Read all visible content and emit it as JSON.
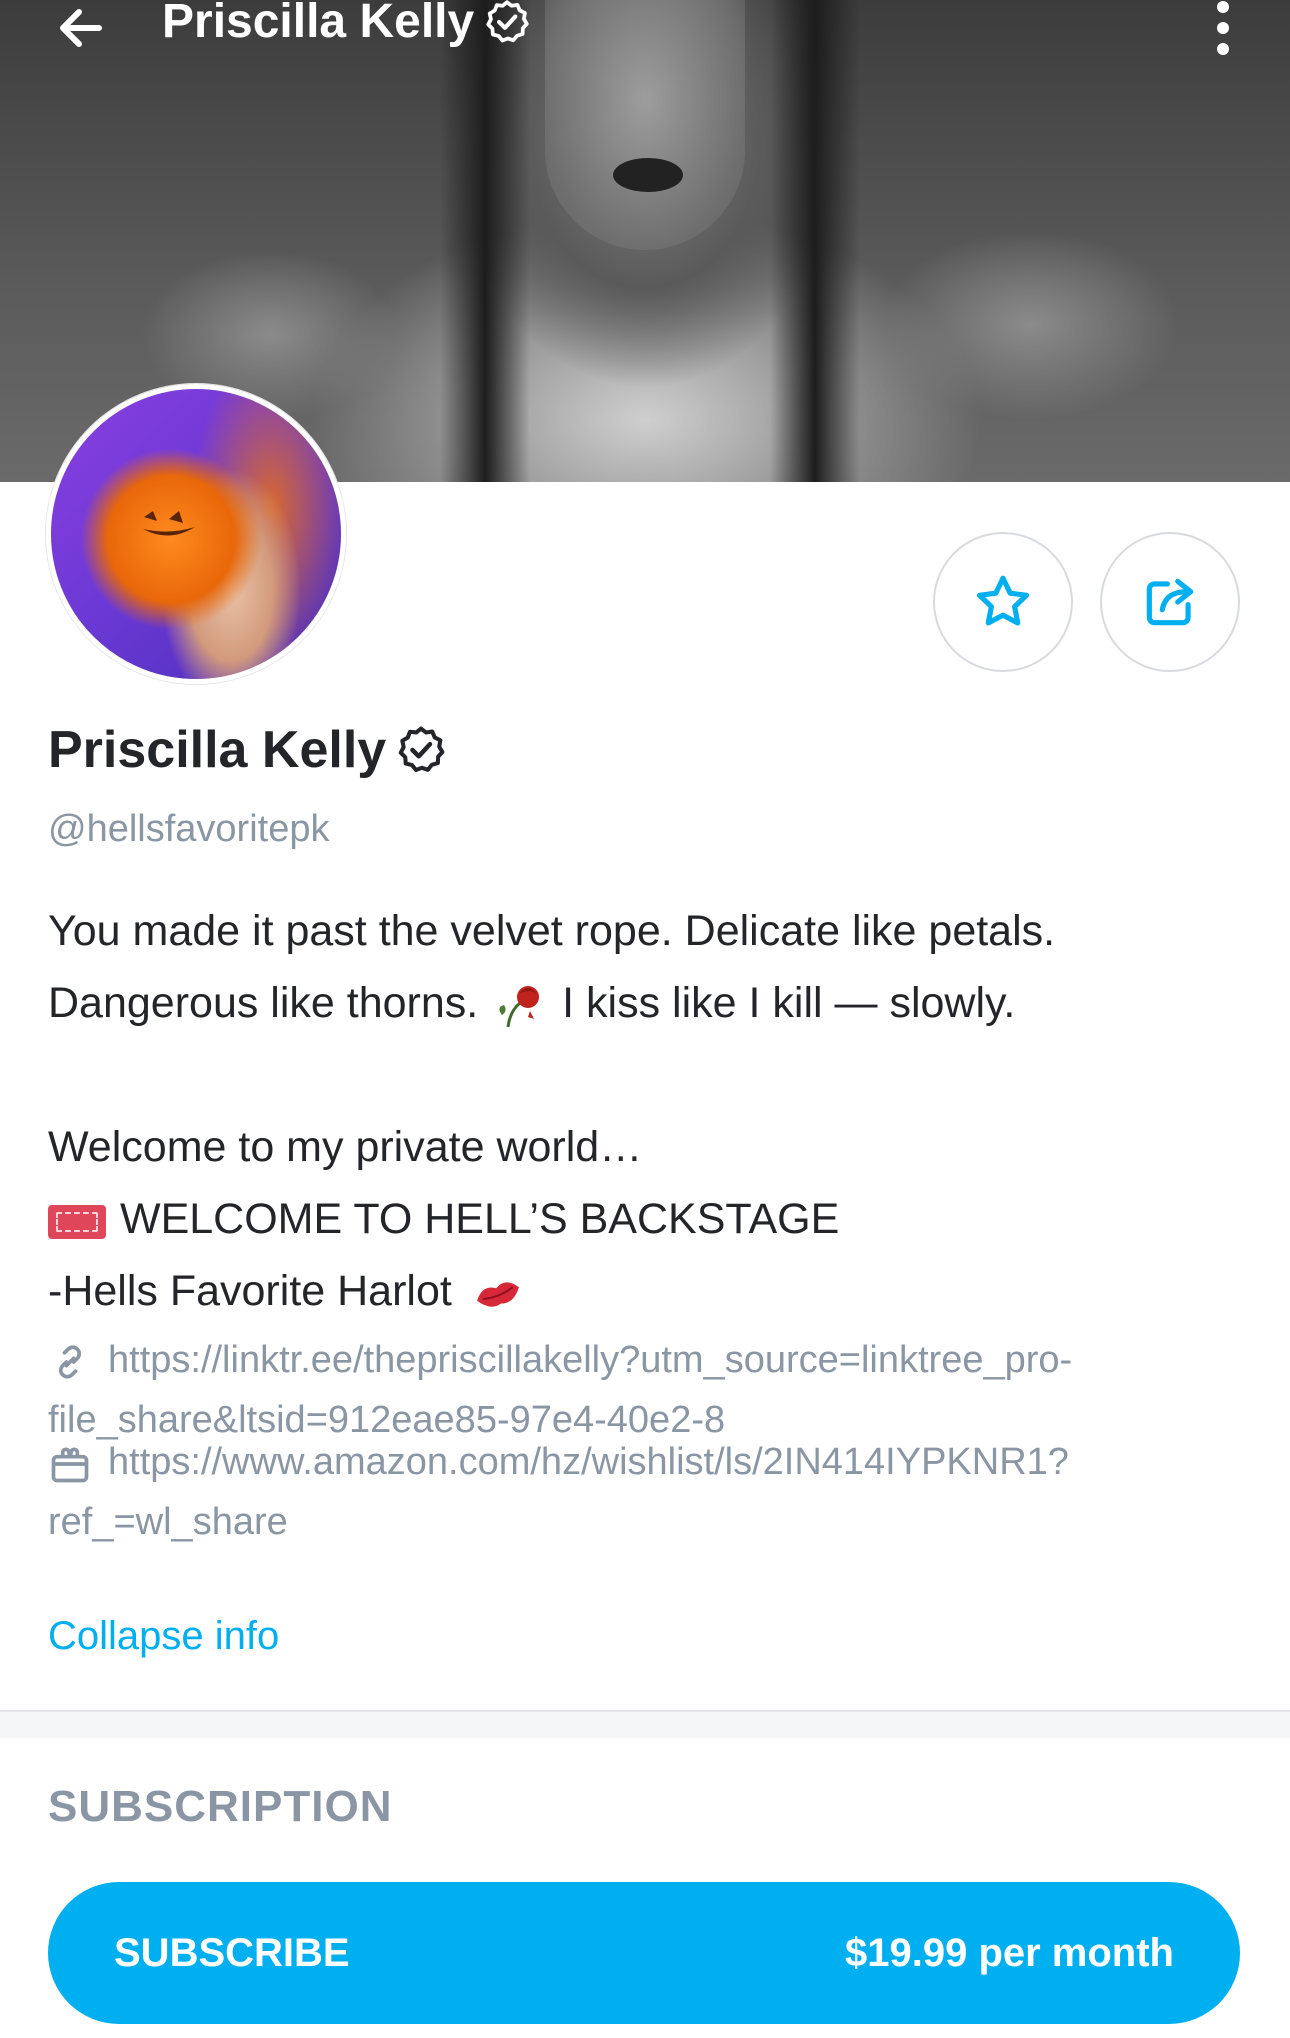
{
  "header": {
    "title": "Priscilla Kelly"
  },
  "profile": {
    "name": "Priscilla Kelly",
    "handle": "@hellsfavoritepk",
    "verified": true
  },
  "bio": {
    "line1": "You made it past the velvet rope. Delicate like petals.",
    "line2a": "Dangerous like thorns.",
    "line2b": "I kiss like I kill — slowly.",
    "line3": "Welcome to my private world…",
    "line4": "WELCOME TO HELL’S BACKSTAGE",
    "line5": "-Hells Favorite Harlot"
  },
  "links": {
    "linktree_line1": "https://linktr.ee/thepriscillakelly?utm_source=linktree_pro-",
    "linktree_line2": "file_share&ltsid=912eae85-97e4-40e2-8",
    "amazon_line1": "https://www.amazon.com/hz/wishlist/ls/2IN414IYPKNR1?",
    "amazon_line2": "ref_=wl_share"
  },
  "collapse_label": "Collapse info",
  "subscription": {
    "section_title": "SUBSCRIPTION",
    "button_label": "SUBSCRIBE",
    "price": "$19.99 per month"
  },
  "colors": {
    "accent": "#00aff0",
    "muted": "#8a96a3",
    "text": "#242529"
  },
  "icons": [
    "back-arrow-icon",
    "verified-badge-icon",
    "more-vertical-icon",
    "star-icon",
    "share-icon",
    "link-icon",
    "gift-icon"
  ]
}
